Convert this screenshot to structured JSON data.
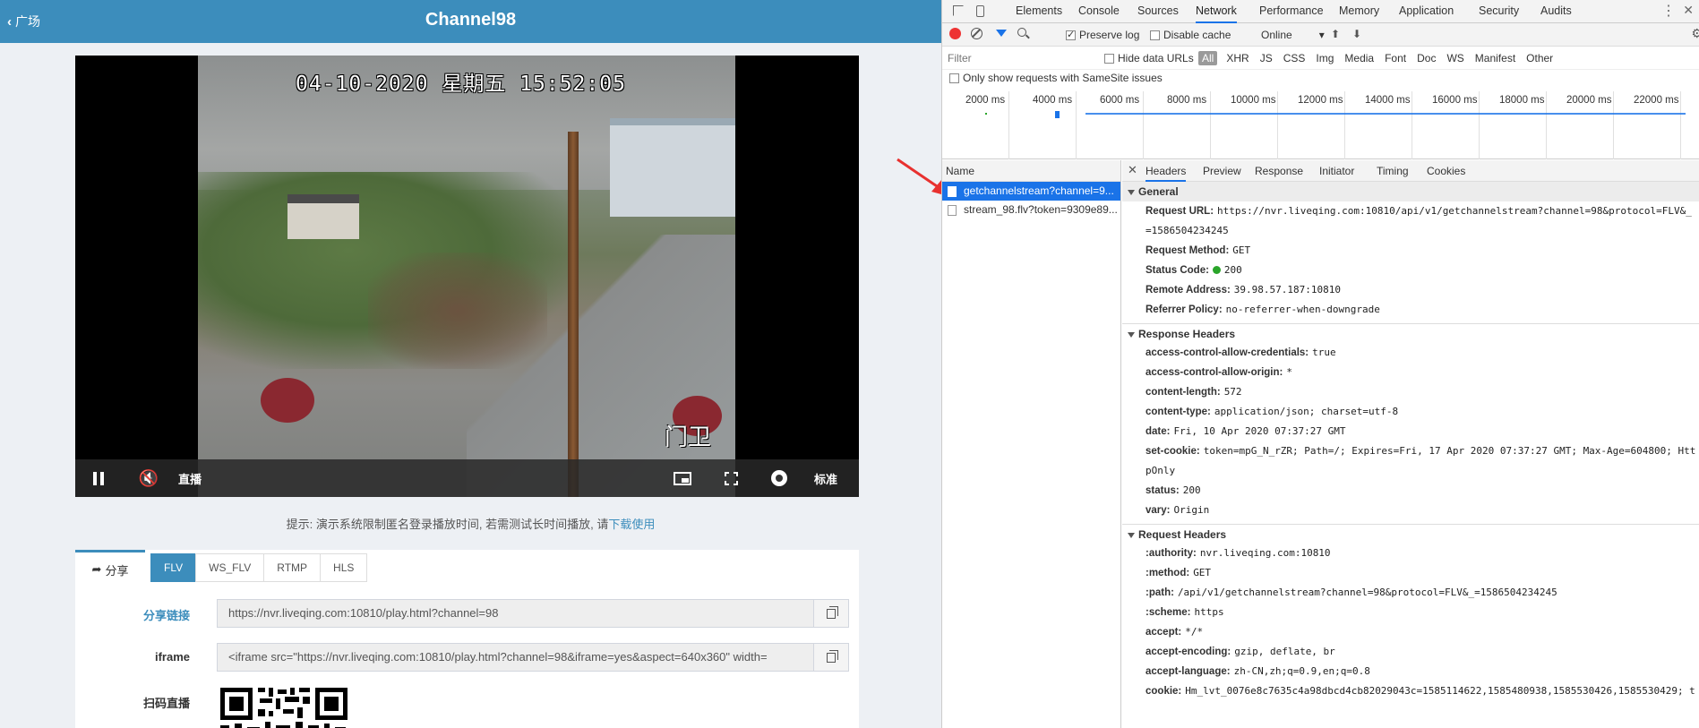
{
  "app": {
    "back_label": "广场",
    "title": "Channel98",
    "video": {
      "timestamp": "04-10-2020 星期五 15:52:05",
      "overlay_label": "门卫"
    },
    "controls": {
      "live_label": "直播",
      "quality_label": "标准"
    },
    "hint": {
      "text": "提示: 演示系统限制匿名登录播放时间, 若需测试长时间播放, 请",
      "link": "下载使用"
    },
    "share": {
      "tab_label": "分享",
      "protocol_tabs": [
        "FLV",
        "WS_FLV",
        "RTMP",
        "HLS"
      ],
      "active_protocol": "FLV",
      "link_label": "分享链接",
      "link_value": "https://nvr.liveqing.com:10810/play.html?channel=98",
      "iframe_label": "iframe",
      "iframe_value": "<iframe src=\"https://nvr.liveqing.com:10810/play.html?channel=98&iframe=yes&aspect=640x360\" width=",
      "qr_label": "扫码直播"
    }
  },
  "devtools": {
    "tabs": [
      "Elements",
      "Console",
      "Sources",
      "Network",
      "Performance",
      "Memory",
      "Application",
      "Security",
      "Audits"
    ],
    "active_tab": "Network",
    "toolbar": {
      "preserve_log": "Preserve log",
      "disable_cache": "Disable cache",
      "throttle": "Online"
    },
    "filter": {
      "placeholder": "Filter",
      "hide_data_urls": "Hide data URLs",
      "types": [
        "All",
        "XHR",
        "JS",
        "CSS",
        "Img",
        "Media",
        "Font",
        "Doc",
        "WS",
        "Manifest",
        "Other"
      ],
      "samesite": "Only show requests with SameSite issues"
    },
    "overview_ticks": [
      "2000 ms",
      "4000 ms",
      "6000 ms",
      "8000 ms",
      "10000 ms",
      "12000 ms",
      "14000 ms",
      "16000 ms",
      "18000 ms",
      "20000 ms",
      "22000 ms"
    ],
    "name_header": "Name",
    "requests": [
      "getchannelstream?channel=9...",
      "stream_98.flv?token=9309e89..."
    ],
    "detail_tabs": [
      "Headers",
      "Preview",
      "Response",
      "Initiator",
      "Timing",
      "Cookies"
    ],
    "general": {
      "title": "General",
      "rows": [
        {
          "k": "Request URL:",
          "v": "https://nvr.liveqing.com:10810/api/v1/getchannelstream?channel=98&protocol=FLV&_=1586504234245"
        },
        {
          "k": "Request Method:",
          "v": "GET"
        },
        {
          "k": "Status Code:",
          "v": "200"
        },
        {
          "k": "Remote Address:",
          "v": "39.98.57.187:10810"
        },
        {
          "k": "Referrer Policy:",
          "v": "no-referrer-when-downgrade"
        }
      ]
    },
    "response_headers": {
      "title": "Response Headers",
      "rows": [
        {
          "k": "access-control-allow-credentials:",
          "v": "true"
        },
        {
          "k": "access-control-allow-origin:",
          "v": "*"
        },
        {
          "k": "content-length:",
          "v": "572"
        },
        {
          "k": "content-type:",
          "v": "application/json; charset=utf-8"
        },
        {
          "k": "date:",
          "v": "Fri, 10 Apr 2020 07:37:27 GMT"
        },
        {
          "k": "set-cookie:",
          "v": "token=mpG_N_rZR; Path=/; Expires=Fri, 17 Apr 2020 07:37:27 GMT; Max-Age=604800; HttpOnly"
        },
        {
          "k": "status:",
          "v": "200"
        },
        {
          "k": "vary:",
          "v": "Origin"
        }
      ]
    },
    "request_headers": {
      "title": "Request Headers",
      "rows": [
        {
          "k": ":authority:",
          "v": "nvr.liveqing.com:10810"
        },
        {
          "k": ":method:",
          "v": "GET"
        },
        {
          "k": ":path:",
          "v": "/api/v1/getchannelstream?channel=98&protocol=FLV&_=1586504234245"
        },
        {
          "k": ":scheme:",
          "v": "https"
        },
        {
          "k": "accept:",
          "v": "*/*"
        },
        {
          "k": "accept-encoding:",
          "v": "gzip, deflate, br"
        },
        {
          "k": "accept-language:",
          "v": "zh-CN,zh;q=0.9,en;q=0.8"
        },
        {
          "k": "cookie:",
          "v": "Hm_lvt_0076e8c7635c4a98dbcd4cb82029043c=1585114622,1585480938,1585530426,1585530429; t"
        }
      ]
    }
  }
}
